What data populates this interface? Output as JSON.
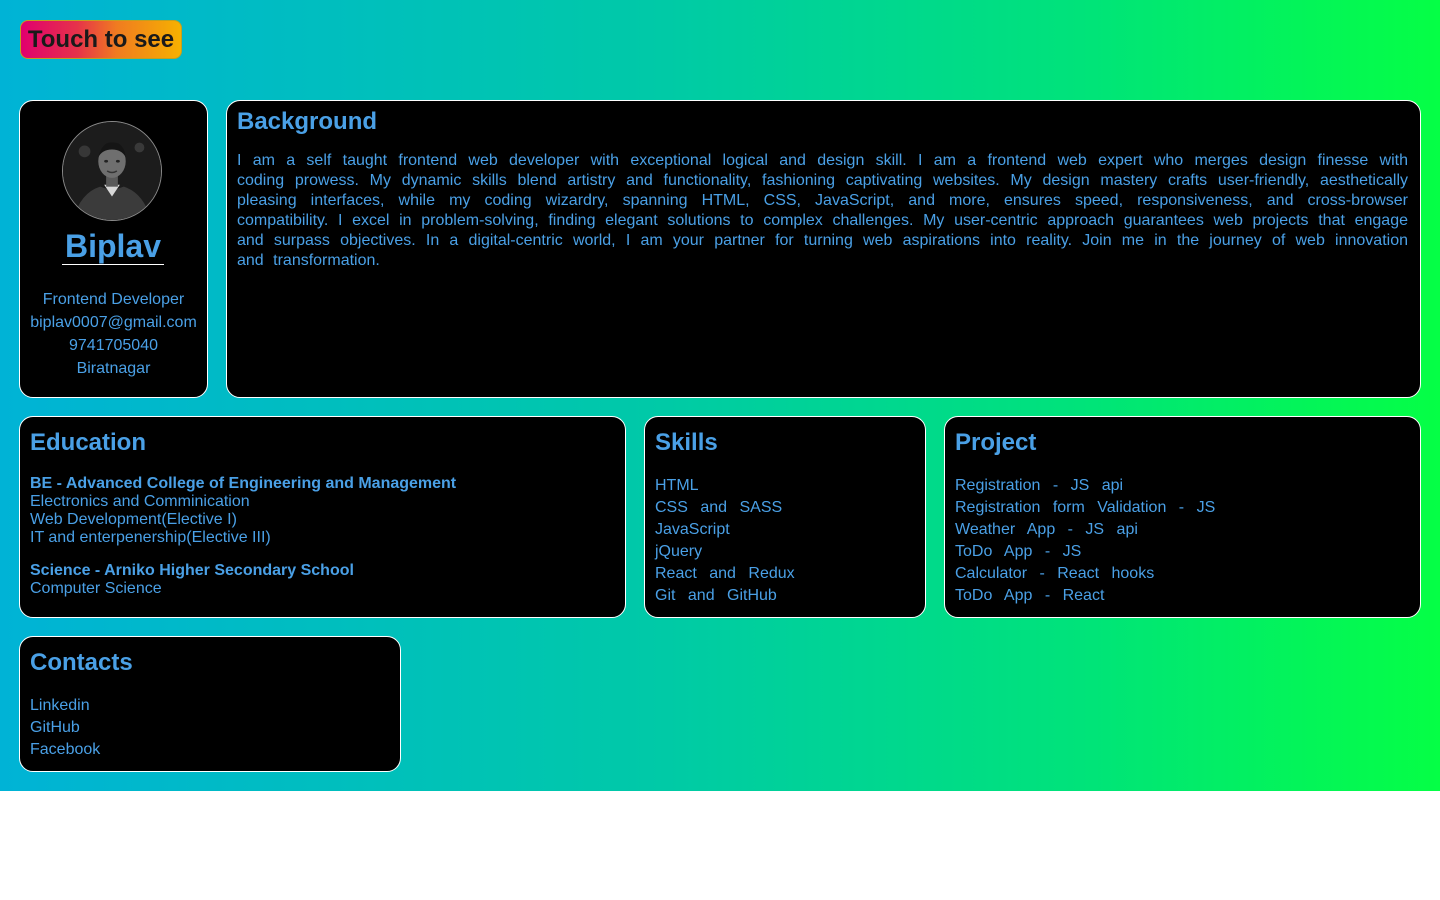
{
  "touch_button": {
    "label": "Touch to see"
  },
  "profile": {
    "name": "Biplav",
    "role": "Frontend Developer",
    "email": "biplav0007@gmail.com",
    "phone": "9741705040",
    "location": "Biratnagar",
    "avatar_icon": "profile-photo"
  },
  "background": {
    "title": "Background",
    "text": "I am a self taught frontend web developer with exceptional logical and design skill. I am a frontend web expert who merges design finesse with coding prowess. My dynamic skills blend artistry and functionality, fashioning captivating websites. My design mastery crafts user-friendly, aesthetically pleasing interfaces, while my coding wizardry, spanning HTML, CSS, JavaScript, and more, ensures speed, responsiveness, and cross-browser compatibility. I excel in problem-solving, finding elegant solutions to complex challenges. My user-centric approach guarantees web projects that engage and surpass objectives. In a digital-centric world, I am your partner for turning web aspirations into reality. Join me in the journey of web innovation and transformation."
  },
  "education": {
    "title": "Education",
    "entries": [
      {
        "degree": "BE - Advanced College of Engineering and Management",
        "details": [
          "Electronics and Comminication",
          "Web Development(Elective I)",
          "IT and enterpenership(Elective III)"
        ]
      },
      {
        "degree": "Science - Arniko Higher Secondary School",
        "details": [
          "Computer Science"
        ]
      }
    ]
  },
  "skills": {
    "title": "Skills",
    "items": [
      "HTML",
      "CSS and SASS",
      "JavaScript",
      "jQuery",
      "React and Redux",
      "Git and GitHub"
    ]
  },
  "project": {
    "title": "Project",
    "items": [
      "Registration - JS api",
      "Registration form Validation - JS",
      "Weather App - JS api",
      "ToDo App - JS",
      "Calculator - React hooks",
      "ToDo App - React"
    ]
  },
  "contacts": {
    "title": "Contacts",
    "links": [
      "Linkedin",
      "GitHub",
      "Facebook"
    ]
  },
  "colors": {
    "text_accent": "#4aa0e6",
    "card_bg": "#000000",
    "gradient_start": "#00b3d6",
    "gradient_end": "#05ff45"
  }
}
